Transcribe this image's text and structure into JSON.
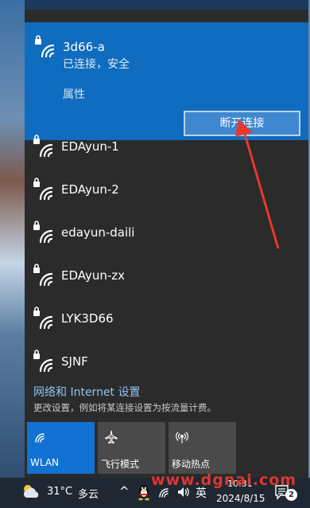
{
  "flyout": {
    "connected": {
      "name": "3d66-a",
      "status": "已连接，安全",
      "properties_label": "属性",
      "disconnect_label": "断开连接"
    },
    "networks": [
      {
        "name": "EDAyun-1"
      },
      {
        "name": "EDAyun-2"
      },
      {
        "name": "edayun-daili"
      },
      {
        "name": "EDAyun-zx"
      },
      {
        "name": "LYK3D66"
      },
      {
        "name": "SJNF"
      }
    ],
    "settings_link": "网络和 Internet 设置",
    "settings_desc": "更改设置，例如将某连接设置为按流量计费。",
    "tiles": [
      {
        "label": "WLAN",
        "icon": "wifi-icon",
        "active": true
      },
      {
        "label": "飞行模式",
        "icon": "airplane-icon",
        "active": false
      },
      {
        "label": "移动热点",
        "icon": "hotspot-icon",
        "active": false
      }
    ]
  },
  "taskbar": {
    "temperature": "31°C",
    "condition": "多云",
    "chevron": "^",
    "ime": "英",
    "time": "10:31",
    "date": "2024/8/15",
    "notification_count": "2"
  },
  "watermark": "www.dgnai.com",
  "colors": {
    "accent": "#0f6cbf",
    "flyout_bg": "#2b2b2b",
    "link": "#8fc3f1",
    "annotation_arrow": "#e8382f"
  }
}
